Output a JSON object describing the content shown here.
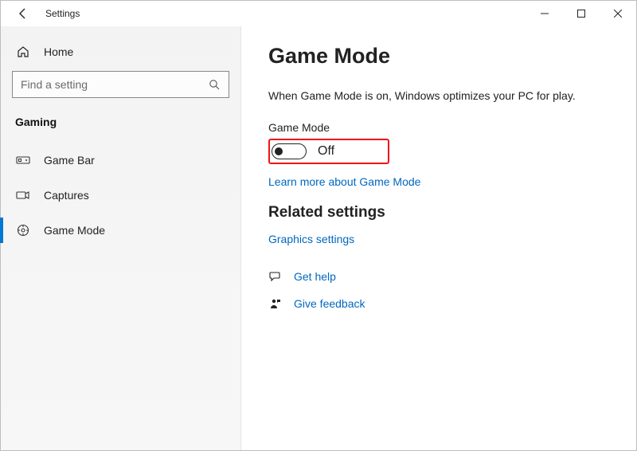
{
  "window": {
    "title": "Settings"
  },
  "sidebar": {
    "home_label": "Home",
    "search_placeholder": "Find a setting",
    "category_label": "Gaming",
    "items": [
      {
        "label": "Game Bar"
      },
      {
        "label": "Captures"
      },
      {
        "label": "Game Mode"
      }
    ],
    "active_index": 2
  },
  "main": {
    "title": "Game Mode",
    "description": "When Game Mode is on, Windows optimizes your PC for play.",
    "toggle_label": "Game Mode",
    "toggle_state_text": "Off",
    "learn_more": "Learn more about Game Mode",
    "related_heading": "Related settings",
    "graphics_link": "Graphics settings",
    "get_help": "Get help",
    "give_feedback": "Give feedback"
  },
  "colors": {
    "accent": "#0078d4",
    "link": "#0067c0",
    "highlight_border": "#f01414"
  }
}
